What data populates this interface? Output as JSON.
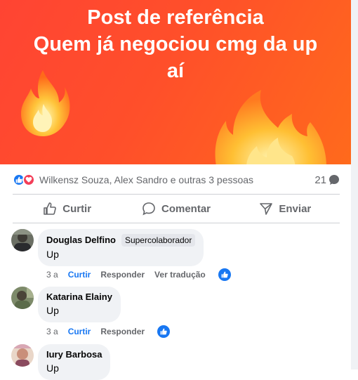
{
  "post": {
    "title_line1": "Post de referência",
    "title_line2": "Quem já negociou cmg da up",
    "title_line3": "aí",
    "reactions_text": "Wilkensz Souza, Alex Sandro e outras 3 pessoas",
    "comment_count": "21",
    "colors": {
      "banner_start": "#ff4433",
      "banner_end": "#ff6a1c",
      "like_blue": "#1877f2",
      "love_red": "#f33e58"
    }
  },
  "actions": {
    "like_label": "Curtir",
    "comment_label": "Comentar",
    "share_label": "Enviar"
  },
  "comments": [
    {
      "author": "Douglas Delfino",
      "badge": "Supercolaborador",
      "text": "Up",
      "time": "3 a",
      "like": "Curtir",
      "reply": "Responder",
      "translate": "Ver tradução"
    },
    {
      "author": "Katarina Elainy",
      "text": "Up",
      "time": "3 a",
      "like": "Curtir",
      "reply": "Responder"
    },
    {
      "author": "Iury Barbosa",
      "text": "Up"
    }
  ],
  "icons": [
    "flame-icon",
    "like-reaction-icon",
    "love-reaction-icon",
    "comment-bubble-icon",
    "thumbs-up-icon",
    "share-icon"
  ]
}
